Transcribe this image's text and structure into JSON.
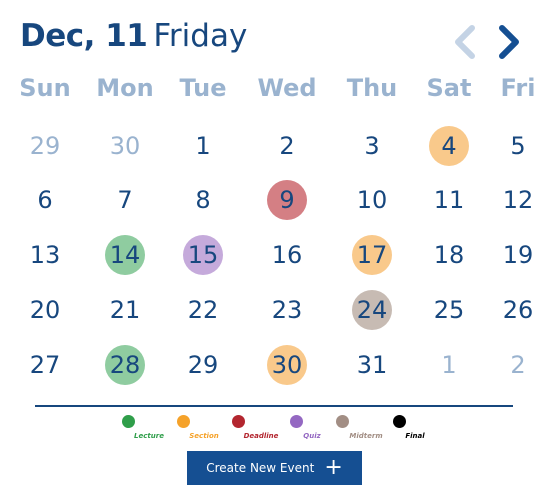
{
  "header": {
    "date": "Dec, 11",
    "weekday": "Friday"
  },
  "colors": {
    "primary": "#17477e",
    "muted": "#9ab3cf",
    "button": "#154f92",
    "lecture": "#8fcca0",
    "section": "#f9c98b",
    "deadline": "#d47f84",
    "quiz": "#c5aadb",
    "midterm": "#c7bbb3"
  },
  "weekdays": [
    "Sun",
    "Mon",
    "Tue",
    "Wed",
    "Thu",
    "Sat",
    "Fri"
  ],
  "weeks": [
    [
      {
        "d": "29",
        "m": true
      },
      {
        "d": "30",
        "m": true
      },
      {
        "d": "1"
      },
      {
        "d": "2"
      },
      {
        "d": "3"
      },
      {
        "d": "4",
        "e": "section"
      },
      {
        "d": "5"
      }
    ],
    [
      {
        "d": "6"
      },
      {
        "d": "7"
      },
      {
        "d": "8"
      },
      {
        "d": "9",
        "e": "deadline"
      },
      {
        "d": "10"
      },
      {
        "d": "11"
      },
      {
        "d": "12"
      }
    ],
    [
      {
        "d": "13"
      },
      {
        "d": "14",
        "e": "lecture"
      },
      {
        "d": "15",
        "e": "quiz"
      },
      {
        "d": "16"
      },
      {
        "d": "17",
        "e": "section"
      },
      {
        "d": "18"
      },
      {
        "d": "19"
      }
    ],
    [
      {
        "d": "20"
      },
      {
        "d": "21"
      },
      {
        "d": "22"
      },
      {
        "d": "23"
      },
      {
        "d": "24",
        "e": "midterm"
      },
      {
        "d": "25"
      },
      {
        "d": "26"
      }
    ],
    [
      {
        "d": "27"
      },
      {
        "d": "28",
        "e": "lecture"
      },
      {
        "d": "29"
      },
      {
        "d": "30",
        "e": "section"
      },
      {
        "d": "31"
      },
      {
        "d": "1",
        "m": true
      },
      {
        "d": "2",
        "m": true
      }
    ]
  ],
  "legend": [
    {
      "label": "Lecture",
      "dot": "#2f9e4a",
      "text": "#2f9e4a"
    },
    {
      "label": "Section",
      "dot": "#f5a22a",
      "text": "#f5a22a"
    },
    {
      "label": "Deadline",
      "dot": "#b3262f",
      "text": "#b3262f"
    },
    {
      "label": "Quiz",
      "dot": "#9468c2",
      "text": "#9468c2"
    },
    {
      "label": "Midterm",
      "dot": "#a28e84",
      "text": "#a28e84"
    },
    {
      "label": "Final",
      "dot": "#000000",
      "text": "#000000"
    }
  ],
  "button": {
    "label": "Create New Event",
    "icon": "plus-icon"
  }
}
